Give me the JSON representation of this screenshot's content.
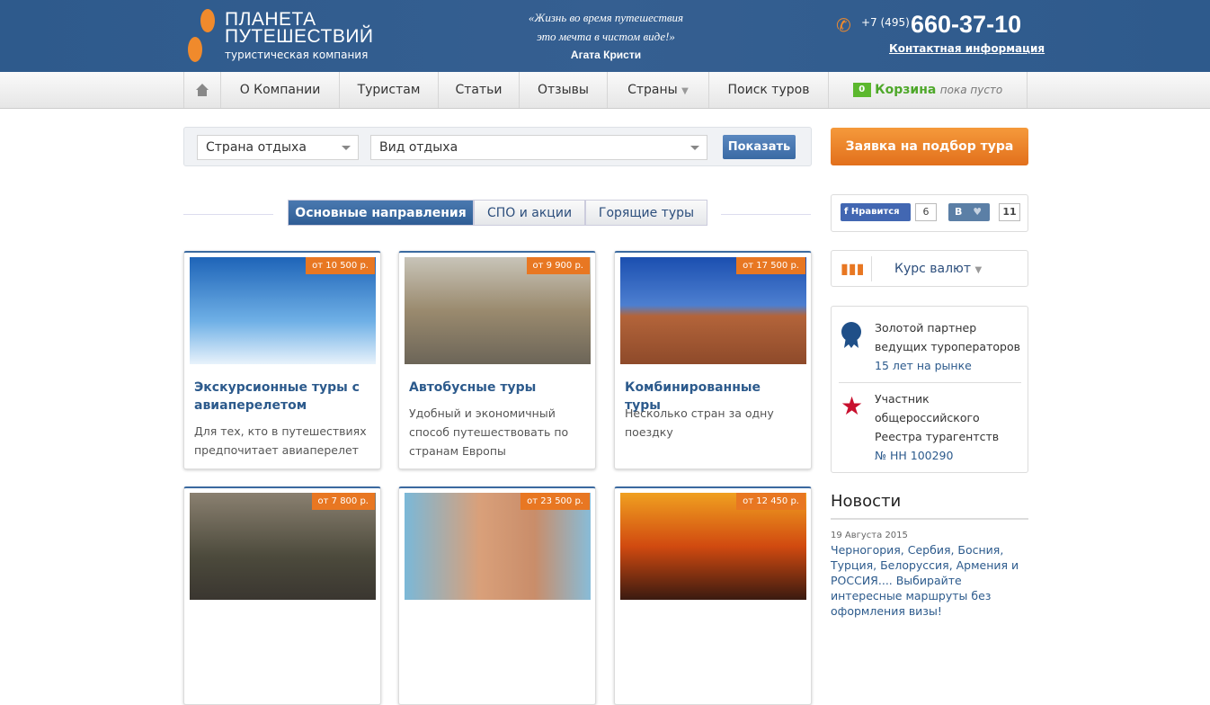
{
  "header": {
    "logo_line1": "ПЛАНЕТА",
    "logo_line2": "ПУТЕШЕСТВИЙ",
    "logo_sub": "туристическая компания",
    "quote_line1": "«Жизнь во время путешествия",
    "quote_line2": "это мечта в чистом виде!»",
    "quote_author": "Агата Кристи",
    "phone_code": "+7 (495)",
    "phone_number": "660-37-10",
    "contact_link": "Контактная информация"
  },
  "nav": {
    "items": [
      "О Компании",
      "Туристам",
      "Статьи",
      "Отзывы",
      "Страны",
      "Поиск туров"
    ],
    "cart_count": "0",
    "cart_label": "Корзина",
    "cart_status": "пока пусто"
  },
  "search": {
    "country": "Страна отдыха",
    "type": "Вид отдыха",
    "button": "Показать"
  },
  "request_button": "Заявка на подбор тура",
  "tabs": [
    "Основные направления",
    "СПО и акции",
    "Горящие туры"
  ],
  "cards": [
    {
      "price": "от 10 500 р.",
      "title": "Экскурсионные туры с авиаперелетом",
      "desc": "Для тех, кто в путешествиях предпочитает авиаперелет"
    },
    {
      "price": "от 9 900 р.",
      "title": "Автобусные туры",
      "desc": "Удобный и экономичный способ путешествовать по странам Европы"
    },
    {
      "price": "от 17 500 р.",
      "title": "Комбинированные туры",
      "desc": "Несколько стран за одну поездку"
    },
    {
      "price": "от 7 800 р."
    },
    {
      "price": "от 23 500 р."
    },
    {
      "price": "от 12 450 р."
    }
  ],
  "social": {
    "fb_label": "Нравится",
    "fb_count": "6",
    "vk_label": "В",
    "vk_count": "11"
  },
  "currency": "Курс валют",
  "badges": [
    {
      "line1": "Золотой партнер",
      "line2": "ведущих туроператоров",
      "link": "15 лет на рынке"
    },
    {
      "line1": "Участник",
      "line2": "общероссийского",
      "line3": "Реестра турагентств",
      "link": "№ НН 100290"
    }
  ],
  "news": {
    "title": "Новости",
    "date": "19 Августа 2015",
    "text": "Черногория, Сербия, Босния, Турция, Белоруссия, Армения и РОССИЯ.... Выбирайте интересные маршруты без оформления визы!"
  }
}
